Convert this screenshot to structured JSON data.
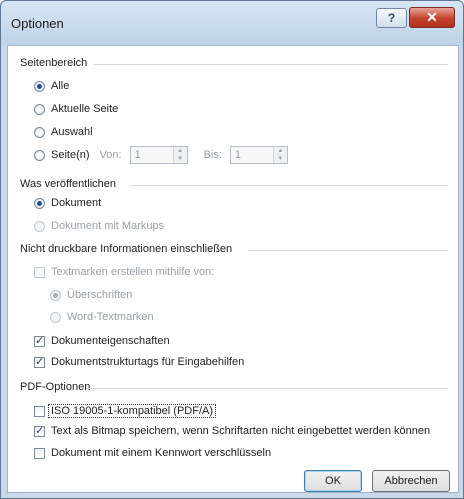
{
  "window": {
    "title": "Optionen",
    "help_glyph": "?",
    "close_glyph": "✕"
  },
  "page_range": {
    "label": "Seitenbereich",
    "options": [
      "Alle",
      "Aktuelle Seite",
      "Auswahl",
      "Seite(n)"
    ],
    "from_label": "Von:",
    "from_value": "1",
    "to_label": "Bis:",
    "to_value": "1"
  },
  "publish": {
    "label": "Was veröffentlichen",
    "options": [
      "Dokument",
      "Dokument mit Markups"
    ]
  },
  "nonprint": {
    "label": "Nicht druckbare Informationen einschließen",
    "bookmarks_label": "Textmarken erstellen mithilfe von:",
    "bookmark_options": [
      "Überschriften",
      "Word-Textmarken"
    ],
    "doc_properties": "Dokumenteigenschaften",
    "struct_tags": "Dokumentstrukturtags für Eingabehilfen"
  },
  "pdf": {
    "label": "PDF-Optionen",
    "iso": "ISO 19005-1-kompatibel (PDF/A)",
    "bitmap": "Text als Bitmap speichern, wenn Schriftarten nicht eingebettet werden können",
    "encrypt": "Dokument mit einem Kennwort verschlüsseln"
  },
  "buttons": {
    "ok": "OK",
    "cancel": "Abbrechen"
  }
}
